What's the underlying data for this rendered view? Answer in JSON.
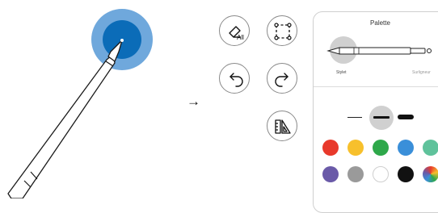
{
  "illustration": {
    "arrow_glyph": "→",
    "pen_tip_ring_color": "#6fa8dc",
    "pen_tip_center_color": "#0b6cb8"
  },
  "tools": {
    "eraser_all": {
      "icon": "eraser-icon",
      "label": "All"
    },
    "lasso_select": {
      "icon": "selection-icon"
    },
    "undo": {
      "icon": "undo-icon"
    },
    "redo": {
      "icon": "redo-icon"
    },
    "ruler": {
      "icon": "ruler-icon"
    }
  },
  "palette": {
    "title": "Palette",
    "pens": [
      {
        "label": "Stylet",
        "selected": true
      },
      {
        "label": "Surligneur",
        "selected": false
      }
    ],
    "stroke_sizes": [
      "thin",
      "medium",
      "thick"
    ],
    "selected_stroke": "medium",
    "colors": [
      {
        "name": "red",
        "hex": "#e8392b"
      },
      {
        "name": "yellow",
        "hex": "#f7c02c"
      },
      {
        "name": "green",
        "hex": "#2ea84a"
      },
      {
        "name": "blue",
        "hex": "#3a8fd9"
      },
      {
        "name": "teal",
        "hex": "#5fc29b"
      },
      {
        "name": "purple",
        "hex": "#6a5aa8"
      },
      {
        "name": "gray",
        "hex": "#9a9a9a"
      },
      {
        "name": "white",
        "hex": "#ffffff"
      },
      {
        "name": "black",
        "hex": "#111111"
      },
      {
        "name": "rainbow",
        "hex": "multicolor"
      }
    ]
  }
}
